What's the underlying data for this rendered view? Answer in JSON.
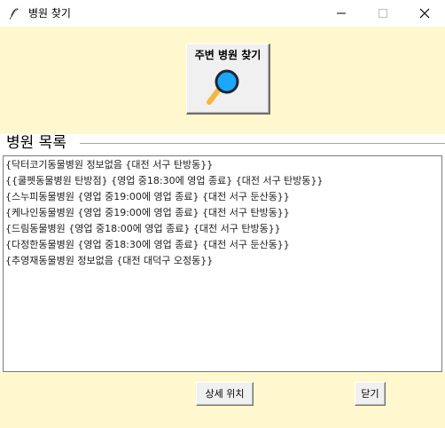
{
  "window": {
    "title": "병원 찾기",
    "app_icon": "feather-icon",
    "controls": {
      "minimize_icon": "minimize-icon",
      "maximize_icon": "maximize-icon",
      "close_icon": "close-icon"
    }
  },
  "search": {
    "button_label": "주변 병원 찾기",
    "icon": "magnifier-icon"
  },
  "hospital_list": {
    "section_title": "병원 목록",
    "items": [
      "{닥터코기동물병원 정보없음 {대전 서구 탄방동}}",
      "{{쿨펫동물병원 탄방점} {영업 중18:30에 영업 종료} {대전 서구 탄방동}}",
      "{스누피동물병원 {영업 중19:00에 영업 종료} {대전 서구 둔산동}}",
      "{케나인동물병원 {영업 중19:00에 영업 종료} {대전 서구 탄방동}}",
      "{드림동물병원 {영업 중18:00에 영업 종료} {대전 서구 탄방동}}",
      "{다정한동물병원 {영업 중18:30에 영업 종료} {대전 서구 둔산동}}",
      "{추영재동물병원 정보없음 {대전 대덕구 오정동}}"
    ]
  },
  "actions": {
    "detail_label": "상세 위치",
    "close_label": "닫기"
  },
  "colors": {
    "window_background": "#fff8cf",
    "search_icon_blue": "#1aa7ff",
    "search_icon_handle": "#f4b740",
    "list_border": "#7a7a7a"
  }
}
